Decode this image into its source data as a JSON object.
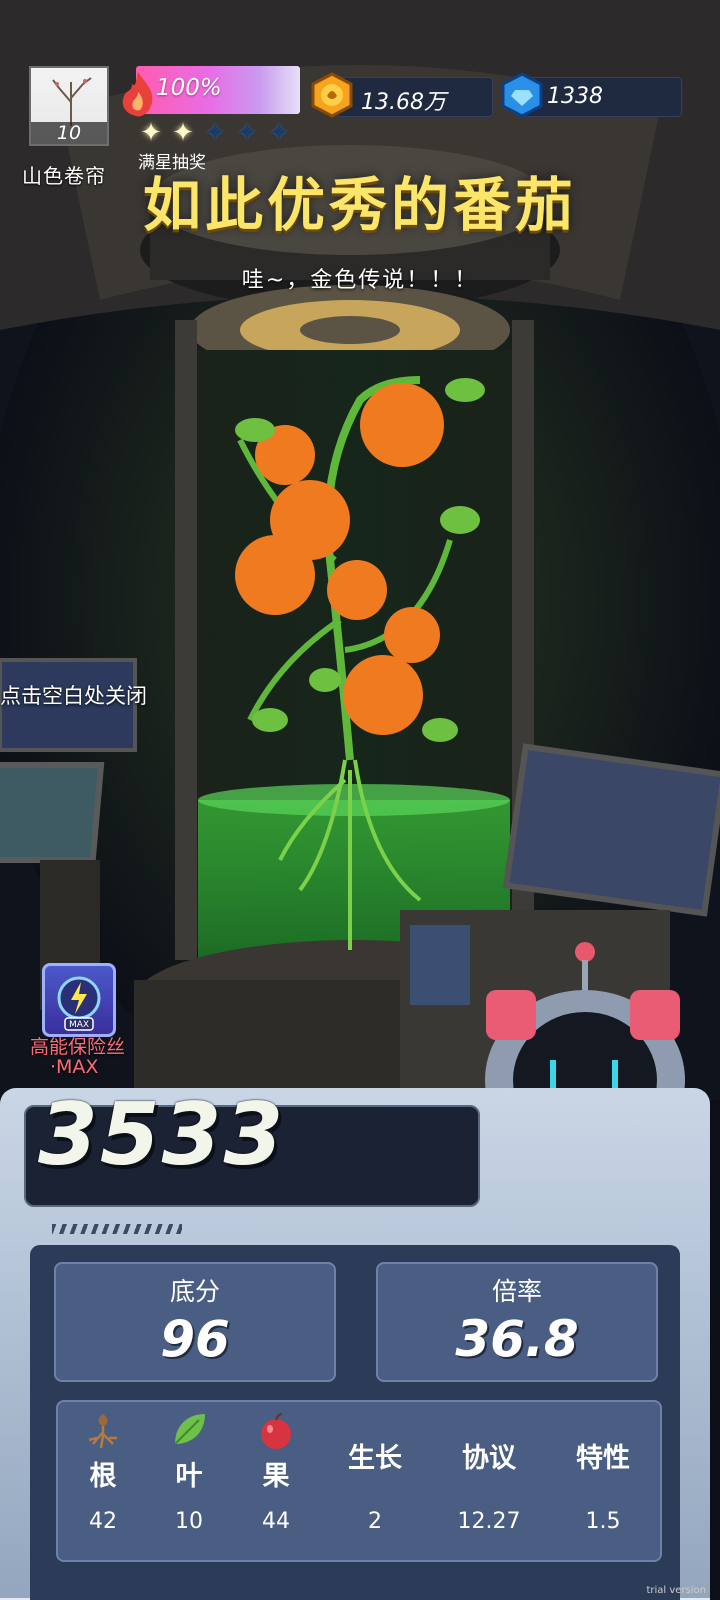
{
  "hud": {
    "avatar_level": "10",
    "nickname": "山色卷帘",
    "energy_percent": "100%",
    "stars_on": 2,
    "stars_total": 5,
    "lottery_label": "满星抽奖",
    "gold": "13.68万",
    "gems": "1338"
  },
  "result": {
    "title": "如此优秀的番茄",
    "subtitle": "哇~，金色传说！！！",
    "close_hint": "点击空白处关闭"
  },
  "buff": {
    "name": "高能保险丝",
    "level": "·MAX",
    "badge": "MAX"
  },
  "score": {
    "total": "3533",
    "base_label": "底分",
    "base_value": "96",
    "mult_label": "倍率",
    "mult_value": "36.8"
  },
  "attributes": [
    {
      "name": "根",
      "value": "42",
      "icon": "root-icon"
    },
    {
      "name": "叶",
      "value": "10",
      "icon": "leaf-icon"
    },
    {
      "name": "果",
      "value": "44",
      "icon": "fruit-icon"
    },
    {
      "name": "生长",
      "value": "2"
    },
    {
      "name": "协议",
      "value": "12.27"
    },
    {
      "name": "特性",
      "value": "1.5"
    }
  ],
  "watermark": "trial version",
  "colors": {
    "title": "#fbe66a",
    "energy_bar": "#e86de6",
    "panel": "#2b3b58",
    "card": "#4a5d83",
    "buff_text": "#ff6a75"
  }
}
